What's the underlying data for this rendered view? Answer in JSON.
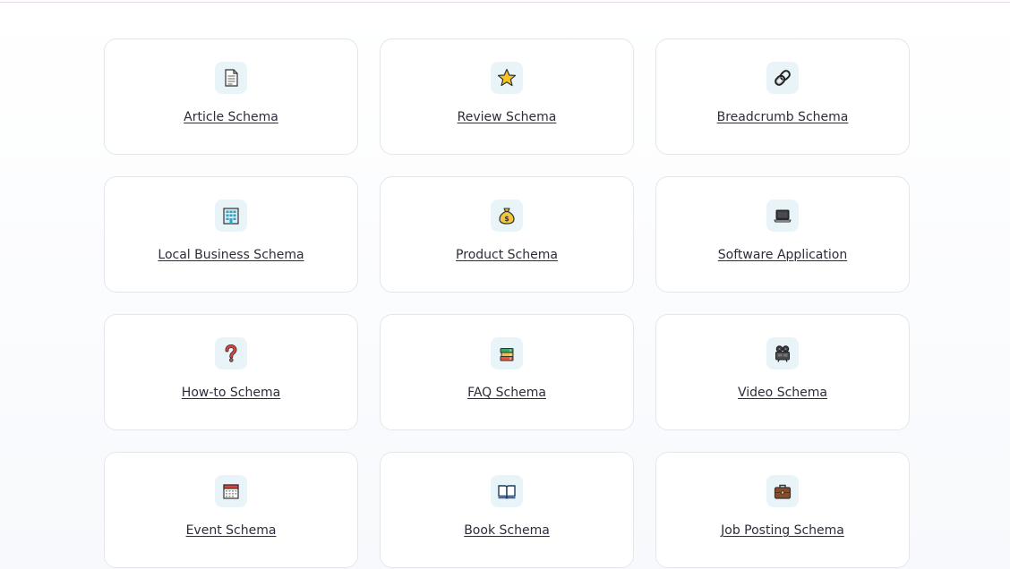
{
  "schema_cards": [
    {
      "label": "Article Schema",
      "icon": "document-icon"
    },
    {
      "label": "Review Schema",
      "icon": "star-icon"
    },
    {
      "label": "Breadcrumb Schema",
      "icon": "link-icon"
    },
    {
      "label": "Local Business Schema",
      "icon": "office-building-icon"
    },
    {
      "label": "Product Schema",
      "icon": "money-bag-icon"
    },
    {
      "label": "Software Application",
      "icon": "laptop-icon"
    },
    {
      "label": "How-to Schema",
      "icon": "question-mark-icon"
    },
    {
      "label": "FAQ Schema",
      "icon": "books-icon"
    },
    {
      "label": "Video Schema",
      "icon": "film-projector-icon"
    },
    {
      "label": "Event Schema",
      "icon": "calendar-icon"
    },
    {
      "label": "Book Schema",
      "icon": "open-book-icon"
    },
    {
      "label": "Job Posting Schema",
      "icon": "briefcase-icon"
    }
  ],
  "colors": {
    "card_border": "#e4e6ec",
    "icon_tile": "#e9f4f9",
    "label_text": "#2b2d3a"
  }
}
